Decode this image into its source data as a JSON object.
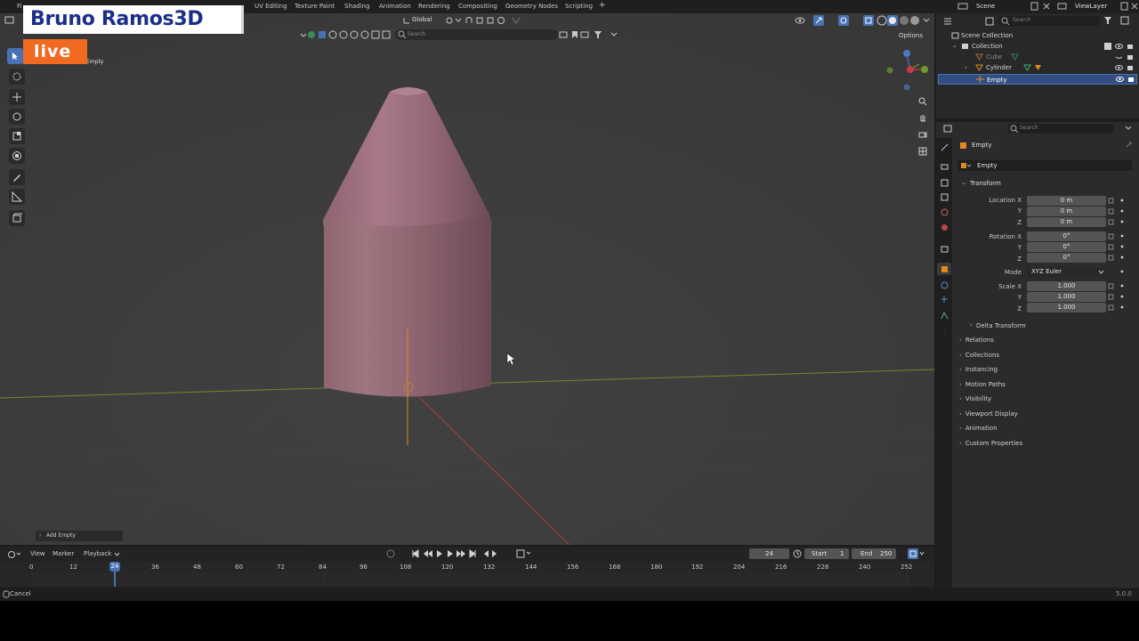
{
  "overlay": {
    "brand": "Bruno Ramos3D",
    "live": "live"
  },
  "topbar": {
    "menu_partial": "Fi",
    "workspaces": [
      "UV Editing",
      "Texture Paint",
      "Shading",
      "Animation",
      "Rendering",
      "Compositing",
      "Geometry Nodes",
      "Scripting"
    ],
    "add_tab": "+",
    "scene": "Scene",
    "view_layer": "ViewLayer"
  },
  "viewport_header": {
    "orientation": "Global",
    "search_placeholder": "Search",
    "options": "Options"
  },
  "viewport": {
    "object_label": "Empty",
    "operator_panel": "Add Empty",
    "colors": {
      "background": "#3d3d3d",
      "mesh": "#8f6670",
      "x_axis": "#b33b3b",
      "y_axis": "#6f8a2c",
      "empty": "#e38a1f"
    }
  },
  "outliner": {
    "search_placeholder": "Search",
    "rows": [
      {
        "label": "Scene Collection"
      },
      {
        "label": "Collection"
      },
      {
        "label": "Cube"
      },
      {
        "label": "Cylinder"
      },
      {
        "label": "Empty"
      }
    ]
  },
  "properties": {
    "search_placeholder": "Search",
    "header_object": "Empty",
    "object_name": "Empty",
    "transform": {
      "title": "Transform",
      "location_label": "Location X",
      "location": [
        "0 m",
        "0 m",
        "0 m"
      ],
      "rotation_label": "Rotation X",
      "rotation": [
        "0°",
        "0°",
        "0°"
      ],
      "mode_label": "Mode",
      "mode": "XYZ Euler",
      "scale_label": "Scale X",
      "scale": [
        "1.000",
        "1.000",
        "1.000"
      ],
      "axis_y": "Y",
      "axis_z": "Z"
    },
    "delta_transform": "Delta Transform",
    "sections": [
      "Relations",
      "Collections",
      "Instancing",
      "Motion Paths",
      "Visibility",
      "Viewport Display",
      "Animation",
      "Custom Properties"
    ]
  },
  "timeline": {
    "menus": [
      "View",
      "Marker",
      "Playback"
    ],
    "current_frame": "24",
    "start_label": "Start",
    "start": "1",
    "end_label": "End",
    "end": "250",
    "ruler": [
      "0",
      "12",
      "24",
      "36",
      "48",
      "60",
      "72",
      "84",
      "96",
      "108",
      "120",
      "132",
      "144",
      "156",
      "168",
      "180",
      "192",
      "204",
      "216",
      "228",
      "240",
      "252"
    ]
  },
  "statusbar": {
    "left": "Cancel",
    "version": "5.0.0"
  }
}
